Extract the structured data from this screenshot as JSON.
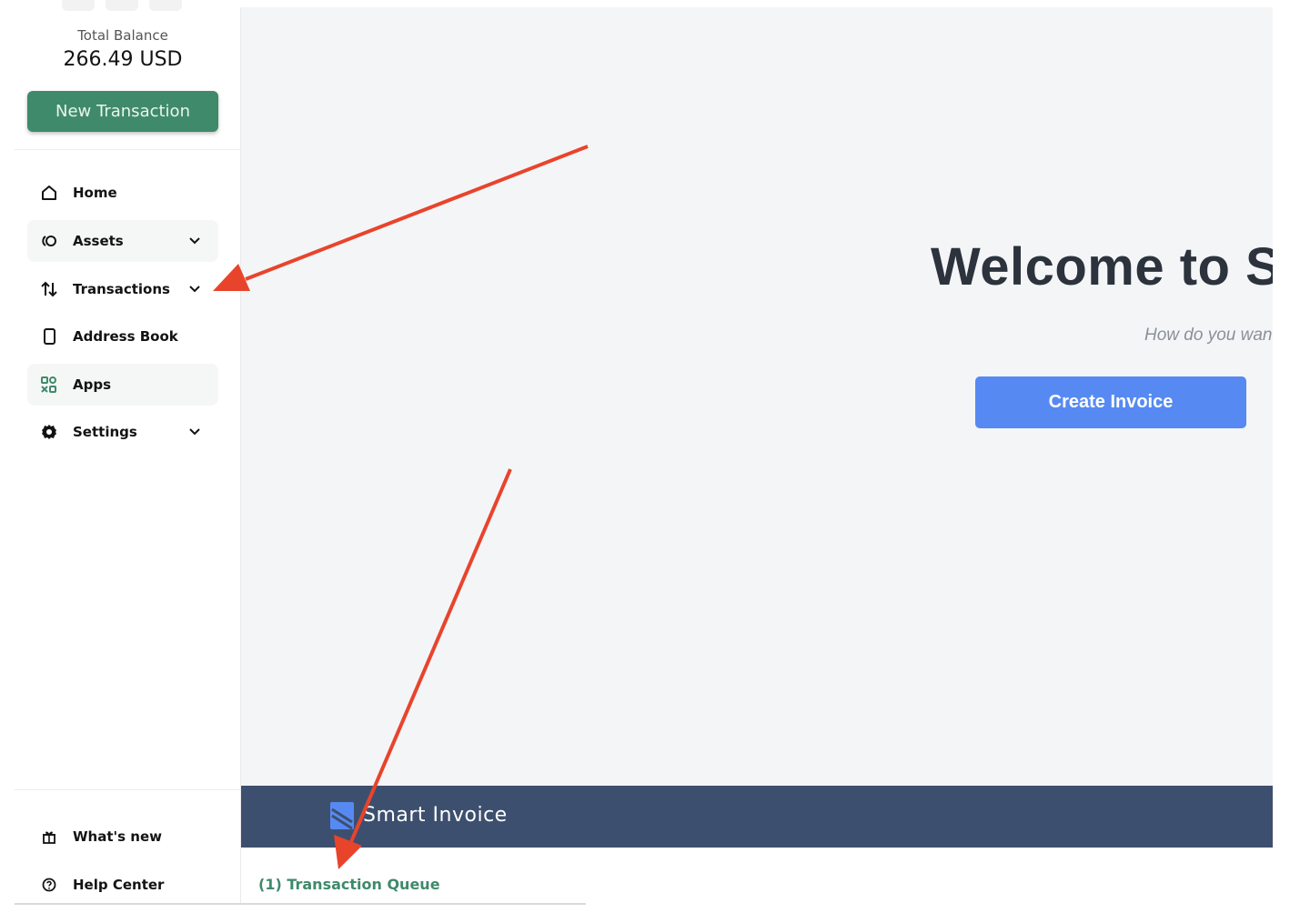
{
  "sidebar": {
    "balance_label": "Total Balance",
    "balance_value": "266.49 USD",
    "new_transaction_label": "New Transaction",
    "nav_items": [
      {
        "label": "Home",
        "icon": "home-icon"
      },
      {
        "label": "Assets",
        "icon": "assets-icon",
        "expandable": true
      },
      {
        "label": "Transactions",
        "icon": "transactions-icon",
        "expandable": true
      },
      {
        "label": "Address Book",
        "icon": "address-book-icon"
      },
      {
        "label": "Apps",
        "icon": "apps-icon",
        "active": true
      },
      {
        "label": "Settings",
        "icon": "gear-icon",
        "expandable": true
      }
    ],
    "footer_items": [
      {
        "label": "What's new",
        "icon": "gift-icon"
      },
      {
        "label": "Help Center",
        "icon": "help-icon"
      }
    ]
  },
  "main": {
    "welcome_title": "Welcome to S",
    "welcome_subtitle": "How do you wan",
    "create_invoice_label": "Create Invoice"
  },
  "app_footer": {
    "brand": "Smart Invoice"
  },
  "transaction_queue": {
    "label": "(1) Transaction Queue"
  },
  "colors": {
    "primary_green": "#3f8a6b",
    "invoice_blue": "#568af2",
    "footer_navy": "#3d4f6e",
    "annotation_red": "#e8442c"
  }
}
